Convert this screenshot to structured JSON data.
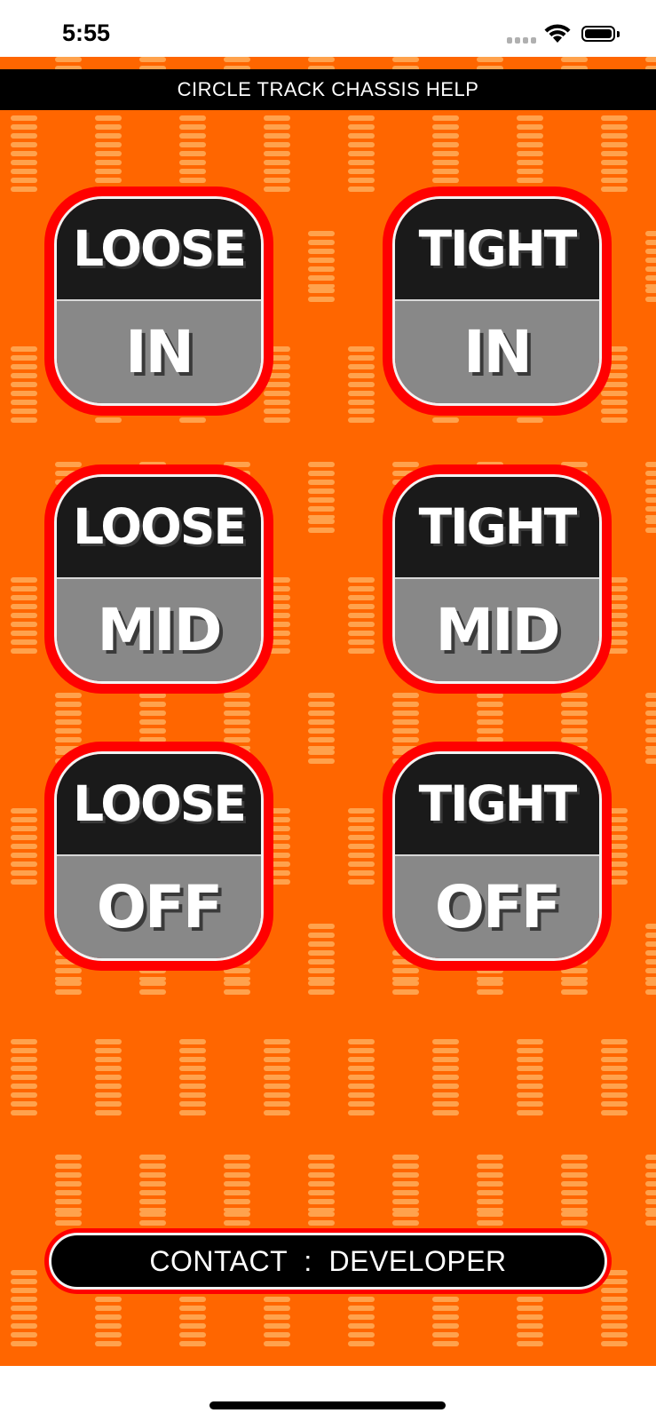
{
  "status_bar": {
    "time": "5:55",
    "signal_icon": "cellular-signal-icon",
    "wifi_icon": "wifi-icon",
    "battery_icon": "battery-icon"
  },
  "header": {
    "title": "CIRCLE TRACK CHASSIS HELP"
  },
  "buttons": [
    {
      "word": "LOOSE",
      "position": "IN"
    },
    {
      "word": "TIGHT",
      "position": "IN"
    },
    {
      "word": "LOOSE",
      "position": "MID"
    },
    {
      "word": "TIGHT",
      "position": "MID"
    },
    {
      "word": "LOOSE",
      "position": "OFF"
    },
    {
      "word": "TIGHT",
      "position": "OFF"
    }
  ],
  "footer": {
    "contact_label": "CONTACT  :  DEVELOPER"
  },
  "colors": {
    "background": "#ff6600",
    "button_border": "#ff0000",
    "button_top": "#1a1a1a",
    "button_bottom": "#888888",
    "title_bar": "#000000",
    "spring_pattern": "#ffa24d"
  },
  "background_pattern": "spring-pattern"
}
